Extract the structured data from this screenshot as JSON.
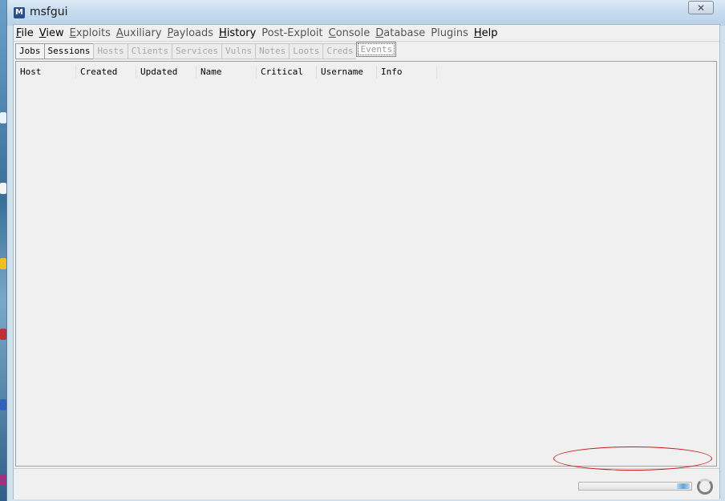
{
  "window": {
    "title": "msfgui",
    "app_icon_glyph": "M",
    "close_glyph": "✕"
  },
  "menubar": {
    "items": [
      {
        "label": "File",
        "mnemonic": "F",
        "rest": "ile",
        "enabled": true
      },
      {
        "label": "View",
        "mnemonic": "V",
        "rest": "iew",
        "enabled": true
      },
      {
        "label": "Exploits",
        "mnemonic": "E",
        "rest": "xploits",
        "enabled": false
      },
      {
        "label": "Auxiliary",
        "mnemonic": "A",
        "rest": "uxiliary",
        "enabled": false
      },
      {
        "label": "Payloads",
        "mnemonic": "P",
        "rest": "ayloads",
        "enabled": false
      },
      {
        "label": "History",
        "mnemonic": "H",
        "rest": "istory",
        "enabled": true
      },
      {
        "label": "Post-Exploit",
        "mnemonic": "",
        "rest": "Post-Exploit",
        "enabled": false
      },
      {
        "label": "Console",
        "mnemonic": "C",
        "rest": "onsole",
        "enabled": false
      },
      {
        "label": "Database",
        "mnemonic": "D",
        "rest": "atabase",
        "enabled": false
      },
      {
        "label": "Plugins",
        "mnemonic": "",
        "rest": "Plugins",
        "enabled": false
      },
      {
        "label": "Help",
        "mnemonic": "H",
        "rest": "elp",
        "enabled": true
      }
    ]
  },
  "tabs": [
    {
      "label": "Jobs",
      "state": "enabled"
    },
    {
      "label": "Sessions",
      "state": "enabled"
    },
    {
      "label": "Hosts",
      "state": "disabled"
    },
    {
      "label": "Clients",
      "state": "disabled"
    },
    {
      "label": "Services",
      "state": "disabled"
    },
    {
      "label": "Vulns",
      "state": "disabled"
    },
    {
      "label": "Notes",
      "state": "disabled"
    },
    {
      "label": "Loots",
      "state": "disabled"
    },
    {
      "label": "Creds",
      "state": "disabled"
    },
    {
      "label": "Events",
      "state": "selected"
    }
  ],
  "table": {
    "columns": [
      "Host",
      "Created",
      "Updated",
      "Name",
      "Critical",
      "Username",
      "Info"
    ],
    "rows": []
  },
  "statusbar": {
    "progress_indeterminate": true
  },
  "colors": {
    "highlight": "#cc1a1a",
    "progress": "#5ba7e0",
    "titlebar": "#c6dbee"
  }
}
